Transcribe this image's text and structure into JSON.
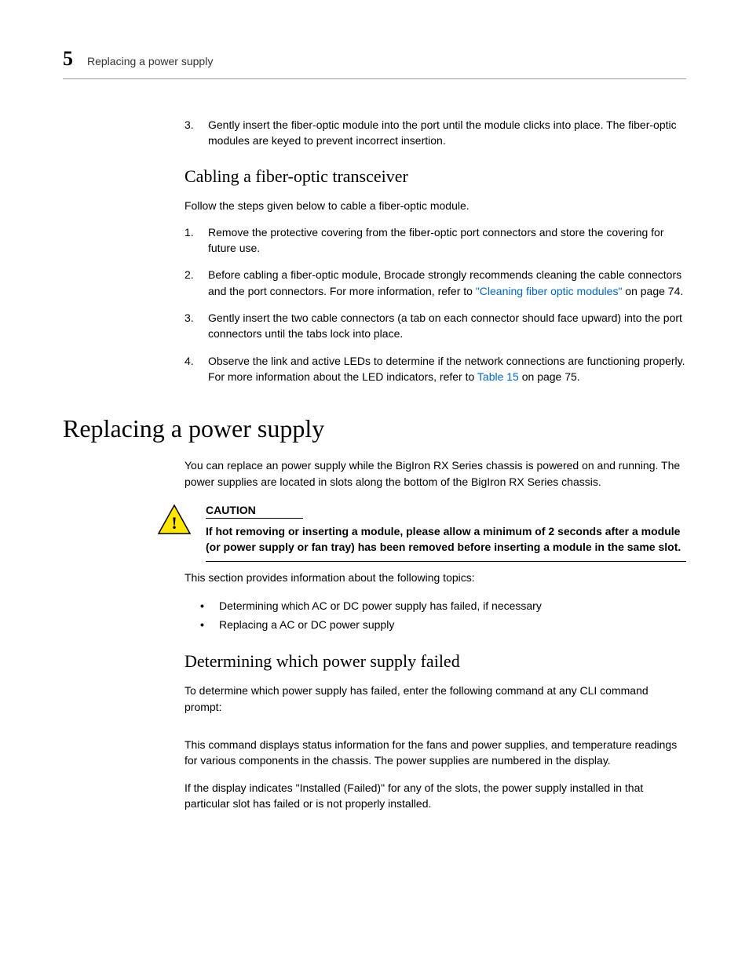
{
  "header": {
    "chapter_number": "5",
    "title": "Replacing a power supply"
  },
  "step3_top": {
    "num": "3.",
    "text": "Gently insert the fiber-optic module into the port until the module clicks into place. The fiber-optic modules are keyed to prevent incorrect insertion."
  },
  "cabling": {
    "heading": "Cabling a fiber-optic transceiver",
    "intro": "Follow the steps given below to cable a fiber-optic module.",
    "steps": [
      {
        "num": "1.",
        "text": "Remove the protective covering from the fiber-optic port connectors and store the covering for future use."
      },
      {
        "num": "2.",
        "pre": "Before cabling a fiber-optic module, Brocade strongly recommends cleaning the cable connectors and the port connectors. For more information, refer to ",
        "link": "\"Cleaning fiber optic modules\"",
        "post": " on page 74."
      },
      {
        "num": "3.",
        "text": "Gently insert the two cable connectors (a tab on each connector should face upward) into the port connectors until the tabs lock into place."
      },
      {
        "num": "4.",
        "pre": "Observe the link and active LEDs to determine if the network connections are functioning properly. For more information about the LED indicators, refer to ",
        "link": "Table 15",
        "post": " on page 75."
      }
    ]
  },
  "replacing": {
    "heading": "Replacing a power supply",
    "intro": "You can replace an power supply while the BigIron RX Series chassis is powered on and running. The power supplies are located in slots along the bottom of the BigIron RX Series chassis.",
    "caution_label": "CAUTION",
    "caution_text": "If hot removing or inserting a module, please allow a minimum of 2 seconds after a module (or power supply or fan tray) has been removed before inserting a module in the same slot.",
    "topics_intro": "This section provides information about the following topics:",
    "topics": [
      "Determining which AC or DC power supply has failed, if necessary",
      "Replacing a AC or DC power supply"
    ]
  },
  "determining": {
    "heading": "Determining which power supply failed",
    "p1": "To determine which power supply has failed, enter the following command at any CLI command prompt:",
    "p2": "This command displays status information for the fans and power supplies, and temperature readings for various components in the chassis. The power supplies are numbered in the display.",
    "p3": "If the display indicates \"Installed (Failed)\" for any of the slots, the power supply installed in that particular slot has failed or is not properly installed."
  }
}
